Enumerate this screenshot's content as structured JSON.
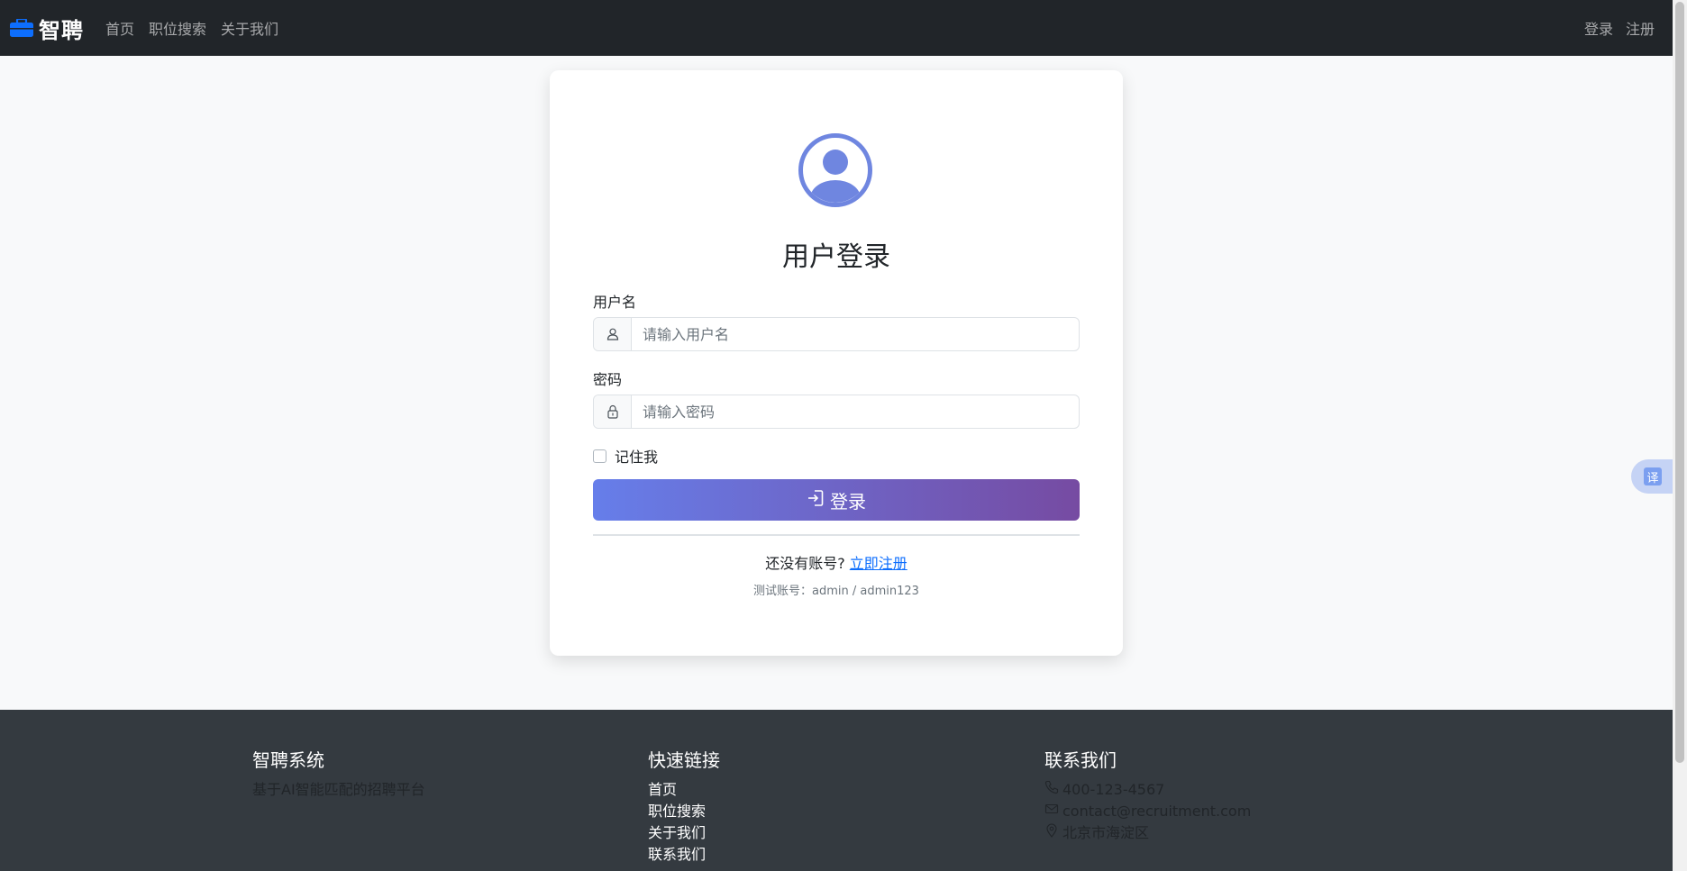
{
  "navbar": {
    "brand": "智聘",
    "links": [
      "首页",
      "职位搜索",
      "关于我们"
    ],
    "login": "登录",
    "register": "注册"
  },
  "login_card": {
    "title": "用户登录",
    "username_label": "用户名",
    "username_placeholder": "请输入用户名",
    "password_label": "密码",
    "password_placeholder": "请输入密码",
    "remember_label": "记住我",
    "submit_label": "登录",
    "no_account_text": "还没有账号?",
    "register_link": "立即注册",
    "test_account": "测试账号：admin / admin123"
  },
  "translate_button": "译",
  "footer": {
    "col1": {
      "title": "智聘系统",
      "text": "基于AI智能匹配的招聘平台"
    },
    "col2": {
      "title": "快速链接",
      "links": [
        "首页",
        "职位搜索",
        "关于我们",
        "联系我们"
      ]
    },
    "col3": {
      "title": "联系我们",
      "phone": "400-123-4567",
      "email": "contact@recruitment.com",
      "address": "北京市海淀区"
    }
  },
  "colors": {
    "navbar_bg": "#212529",
    "brand_icon": "#0d6efd",
    "button_gradient_start": "#667eea",
    "button_gradient_end": "#764ba2",
    "link": "#0d6efd",
    "footer_bg": "#343a40"
  }
}
